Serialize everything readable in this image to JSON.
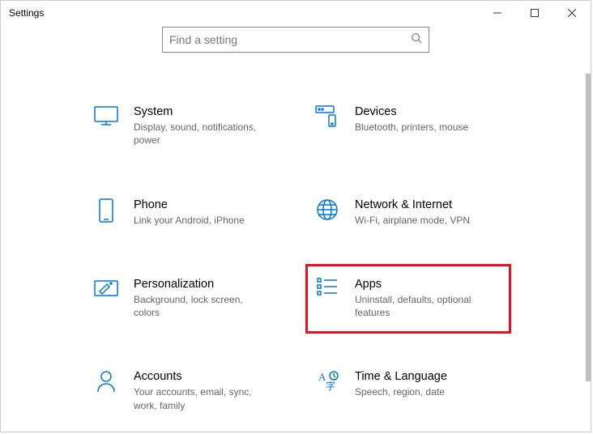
{
  "window": {
    "title": "Settings"
  },
  "search": {
    "placeholder": "Find a setting"
  },
  "categories": [
    {
      "id": "system",
      "title": "System",
      "desc": "Display, sound, notifications, power"
    },
    {
      "id": "devices",
      "title": "Devices",
      "desc": "Bluetooth, printers, mouse"
    },
    {
      "id": "phone",
      "title": "Phone",
      "desc": "Link your Android, iPhone"
    },
    {
      "id": "network-internet",
      "title": "Network & Internet",
      "desc": "Wi-Fi, airplane mode, VPN"
    },
    {
      "id": "personalization",
      "title": "Personalization",
      "desc": "Background, lock screen, colors"
    },
    {
      "id": "apps",
      "title": "Apps",
      "desc": "Uninstall, defaults, optional features"
    },
    {
      "id": "accounts",
      "title": "Accounts",
      "desc": "Your accounts, email, sync, work, family"
    },
    {
      "id": "time-language",
      "title": "Time & Language",
      "desc": "Speech, region, date"
    }
  ],
  "highlighted": "apps",
  "colors": {
    "accent": "#0078d7",
    "highlight": "#e81123"
  }
}
